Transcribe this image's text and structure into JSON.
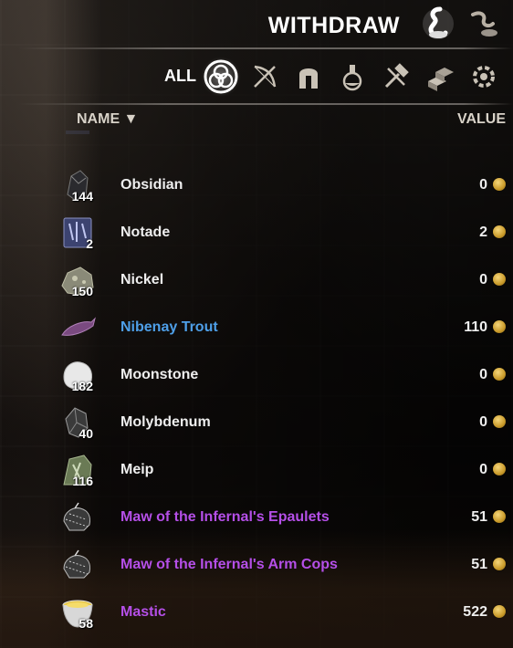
{
  "header": {
    "title": "WITHDRAW"
  },
  "filters": {
    "all_label": "ALL",
    "icons": [
      {
        "name": "all-items-icon",
        "selected": true
      },
      {
        "name": "weapons-icon"
      },
      {
        "name": "armor-icon"
      },
      {
        "name": "consumables-icon"
      },
      {
        "name": "crafting-icon"
      },
      {
        "name": "furnishing-icon"
      },
      {
        "name": "miscellaneous-icon"
      }
    ]
  },
  "columns": {
    "name": "NAME ▼",
    "value": "VALUE"
  },
  "items": [
    {
      "name": "Obsidian",
      "count": "144",
      "value": "0",
      "quality": "normal",
      "icon": "obsidian-icon"
    },
    {
      "name": "Notade",
      "count": "2",
      "value": "2",
      "quality": "normal",
      "icon": "notade-rune-icon"
    },
    {
      "name": "Nickel",
      "count": "150",
      "value": "0",
      "quality": "normal",
      "icon": "nickel-ore-icon"
    },
    {
      "name": "Nibenay Trout",
      "count": "",
      "value": "110",
      "quality": "fine",
      "icon": "trout-fish-icon"
    },
    {
      "name": "Moonstone",
      "count": "182",
      "value": "0",
      "quality": "normal",
      "icon": "moonstone-icon"
    },
    {
      "name": "Molybdenum",
      "count": "40",
      "value": "0",
      "quality": "normal",
      "icon": "molybdenum-icon"
    },
    {
      "name": "Meip",
      "count": "116",
      "value": "0",
      "quality": "normal",
      "icon": "meip-rune-icon"
    },
    {
      "name": "Maw of the Infernal's Epaulets",
      "count": "",
      "value": "51",
      "quality": "epic",
      "icon": "epaulets-icon"
    },
    {
      "name": "Maw of the Infernal's Arm Cops",
      "count": "",
      "value": "51",
      "quality": "epic",
      "icon": "arm-cops-icon"
    },
    {
      "name": "Mastic",
      "count": "58",
      "value": "522",
      "quality": "epic",
      "icon": "mastic-bowl-icon"
    }
  ],
  "colors": {
    "fine": "#4e9fe8",
    "epic": "#b54fe8",
    "normal": "#eeeeee"
  }
}
